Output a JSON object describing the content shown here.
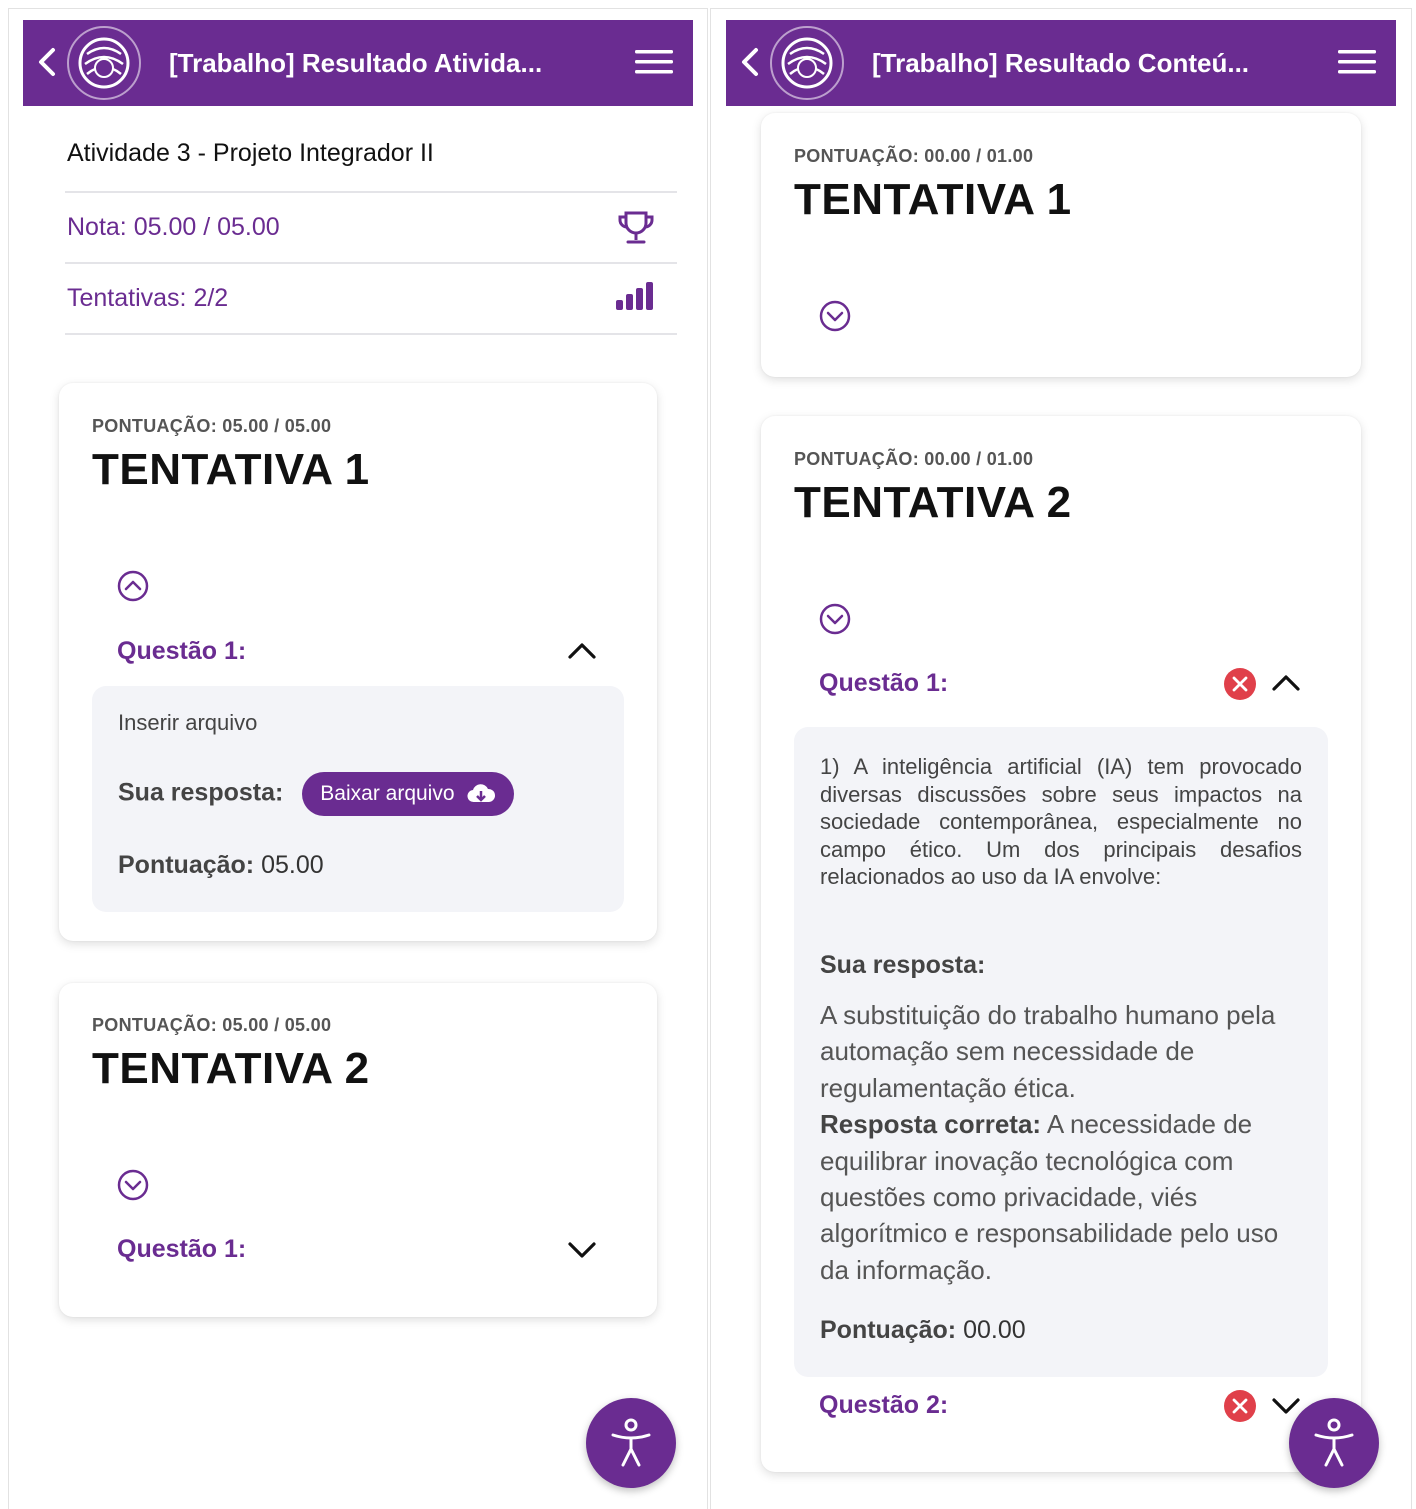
{
  "left": {
    "appbar": {
      "title": "[Trabalho] Resultado Ativida..."
    },
    "activity_title": "Atividade 3 - Projeto Integrador II",
    "grade_label": "Nota: 05.00 / 05.00",
    "attempts_label": "Tentativas: 2/2",
    "cards": [
      {
        "score": "PONTUAÇÃO: 05.00 / 05.00",
        "title": "TENTATIVA 1",
        "question_label": "Questão 1:",
        "prompt": "Inserir arquivo",
        "your_answer_label": "Sua resposta:",
        "download_label": "Baixar arquivo",
        "points_label": "Pontuação:",
        "points_value": "05.00"
      },
      {
        "score": "PONTUAÇÃO: 05.00 / 05.00",
        "title": "TENTATIVA 2",
        "question_label": "Questão 1:"
      }
    ]
  },
  "right": {
    "appbar": {
      "title": "[Trabalho] Resultado Conteú..."
    },
    "cards": [
      {
        "score": "PONTUAÇÃO: 00.00 / 01.00",
        "title": "TENTATIVA 1"
      },
      {
        "score": "PONTUAÇÃO: 00.00 / 01.00",
        "title": "TENTATIVA 2",
        "question1_label": "Questão 1:",
        "question_text": "1) A inteligência artificial (IA) tem provocado diversas discussões sobre seus impactos na sociedade contemporânea, especialmente no campo ético. Um dos principais desafios relacionados ao uso da IA envolve:",
        "your_answer_label": "Sua resposta:",
        "your_answer_text": "A substituição do trabalho humano pela automação sem necessidade de regulamentação ética.",
        "correct_label": "Resposta correta:",
        "correct_text": " A necessidade de equilibrar inovação tecnológica com questões como privacidade, viés algorítmico e responsabilidade pelo uso da informação.",
        "points_label": "Pontuação:",
        "points_value": "00.00",
        "question2_label": "Questão 2:"
      }
    ]
  },
  "colors": {
    "brand": "#6a2c91",
    "error": "#e0404a",
    "panel_bg": "#f3f4f8"
  },
  "icons": [
    "back-arrow-icon",
    "logo",
    "hamburger-menu-icon",
    "trophy-icon",
    "signal-bars-icon",
    "chevron-circle-icon",
    "chevron-up-icon",
    "chevron-down-icon",
    "cloud-download-icon",
    "error-x-icon",
    "accessibility-icon"
  ]
}
